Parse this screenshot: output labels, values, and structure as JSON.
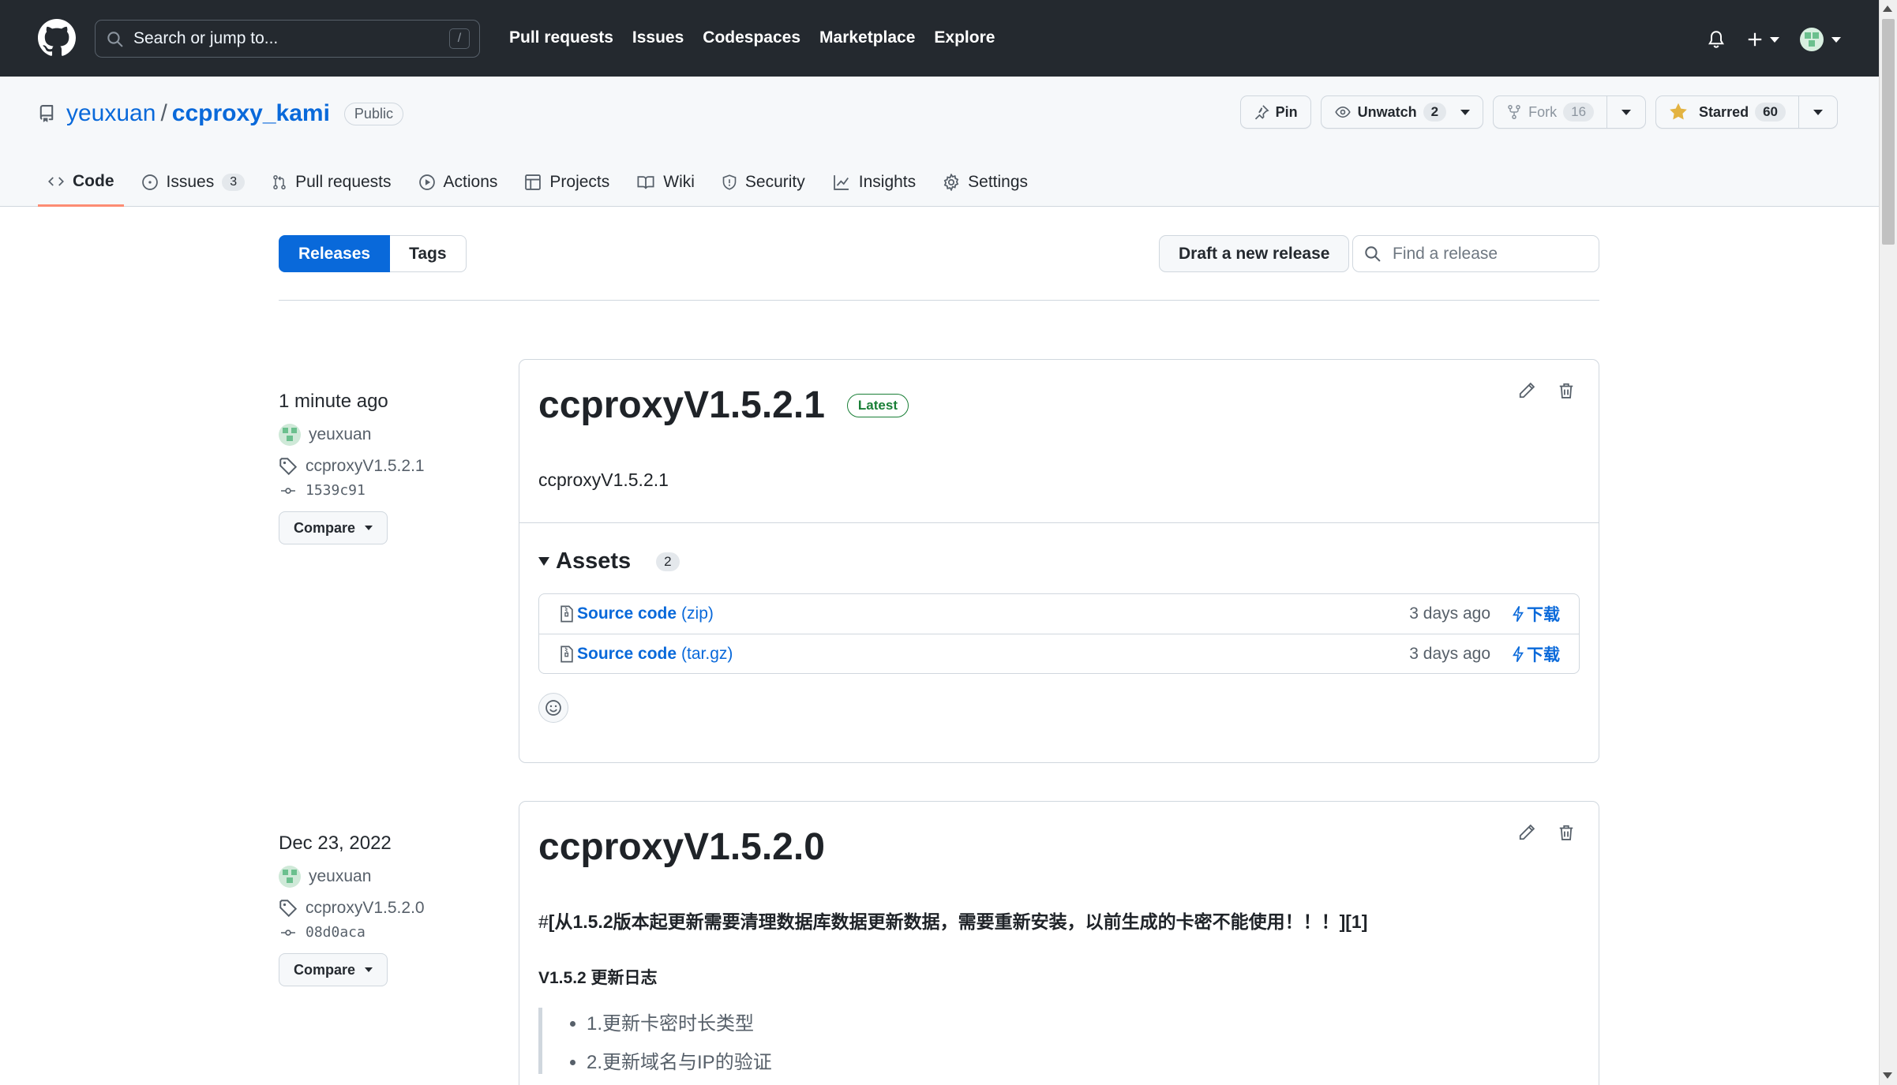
{
  "header": {
    "search_placeholder": "Search or jump to...",
    "search_shortcut": "/",
    "nav": [
      "Pull requests",
      "Issues",
      "Codespaces",
      "Marketplace",
      "Explore"
    ]
  },
  "repo": {
    "owner": "yeuxuan",
    "separator": "/",
    "name": "ccproxy_kami",
    "visibility": "Public",
    "actions": {
      "pin": "Pin",
      "unwatch": "Unwatch",
      "watch_count": "2",
      "fork": "Fork",
      "fork_count": "16",
      "starred": "Starred",
      "star_count": "60"
    },
    "tabs": [
      {
        "label": "Code"
      },
      {
        "label": "Issues",
        "count": "3"
      },
      {
        "label": "Pull requests"
      },
      {
        "label": "Actions"
      },
      {
        "label": "Projects"
      },
      {
        "label": "Wiki"
      },
      {
        "label": "Security"
      },
      {
        "label": "Insights"
      },
      {
        "label": "Settings"
      }
    ]
  },
  "subnav": {
    "releases": "Releases",
    "tags": "Tags",
    "draft": "Draft a new release",
    "find_placeholder": "Find a release"
  },
  "releases": [
    {
      "date": "1 minute ago",
      "author": "yeuxuan",
      "tag": "ccproxyV1.5.2.1",
      "sha": "1539c91",
      "compare": "Compare",
      "title": "ccproxyV1.5.2.1",
      "badge": "Latest",
      "body": "ccproxyV1.5.2.1",
      "assets_label": "Assets",
      "assets_count": "2",
      "assets": [
        {
          "name": "Source code",
          "ext": "(zip)",
          "when": "3 days ago",
          "download": "下载"
        },
        {
          "name": "Source code",
          "ext": "(tar.gz)",
          "when": "3 days ago",
          "download": "下载"
        }
      ]
    },
    {
      "date": "Dec 23, 2022",
      "author": "yeuxuan",
      "tag": "ccproxyV1.5.2.0",
      "sha": "08d0aca",
      "compare": "Compare",
      "title": "ccproxyV1.5.2.0",
      "notice_hash": "#",
      "notice": "[从1.5.2版本起更新需要清理数据库数据更新数据，需要重新安装，以前生成的卡密不能使用！！！][1]",
      "log_title": "V1.5.2 更新日志",
      "log_items": [
        "1.更新卡密时长类型",
        "2.更新域名与IP的验证"
      ]
    }
  ],
  "colors": {
    "header_bg": "#24292f",
    "link": "#0969da",
    "primary_btn": "#0969da",
    "latest_badge": "#1a7f37",
    "active_tab_underline": "#fd8c73"
  }
}
